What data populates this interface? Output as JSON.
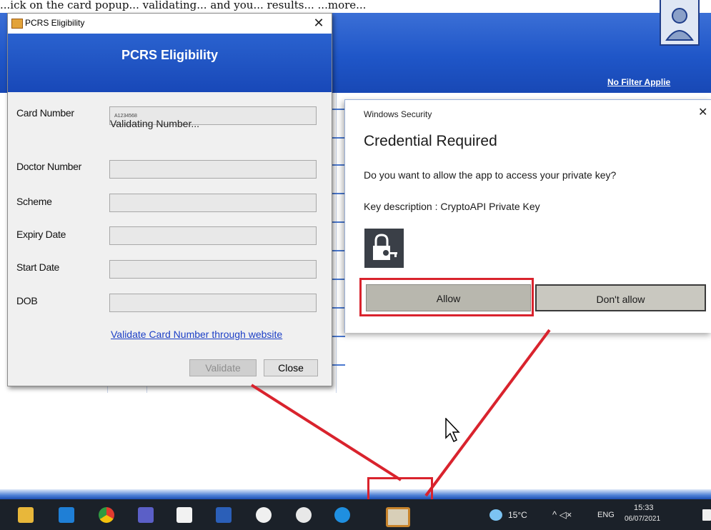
{
  "background_app": {
    "top_caption_text": "...ick on the card popup... validating... and you... results... ...more...",
    "filter_link": "No Filter Applie"
  },
  "pcrs_dialog": {
    "window_title": "PCRS Eligibility",
    "banner_title": "PCRS Eligibility",
    "close_glyph": "✕",
    "fields": [
      {
        "label": "Card Number",
        "value": "A1234568"
      },
      {
        "label": "Doctor Number",
        "value": ""
      },
      {
        "label": "Scheme",
        "value": ""
      },
      {
        "label": "Expiry Date",
        "value": ""
      },
      {
        "label": "Start Date",
        "value": ""
      },
      {
        "label": "DOB",
        "value": ""
      }
    ],
    "status_text": "Validating Number...",
    "website_link": "Validate Card Number through website",
    "validate_button": "Validate",
    "close_button": "Close"
  },
  "windows_security": {
    "caption": "Windows Security",
    "close_glyph": "✕",
    "heading": "Credential Required",
    "question": "Do you want to allow the app to access your private key?",
    "key_description": "Key description  : CryptoAPI Private Key",
    "key_icon": "lock-key-icon",
    "allow_button": "Allow",
    "dont_allow_button": "Don't allow"
  },
  "taskbar": {
    "weather": "15°C",
    "tray_symbols": "^  ◁×",
    "language": "ENG",
    "time": "15:33",
    "date": "06/07/2021",
    "icons": [
      "file-explorer-icon",
      "outlook-icon",
      "chrome-icon",
      "teams-icon",
      "store-icon",
      "word-icon",
      "app-icon",
      "app-icon-2",
      "plus-app-icon",
      "pcrs-app-icon"
    ]
  },
  "colors": {
    "annotation_red": "#d9232d",
    "banner_blue": "#1f56c8",
    "taskbar": "#1b2129"
  }
}
